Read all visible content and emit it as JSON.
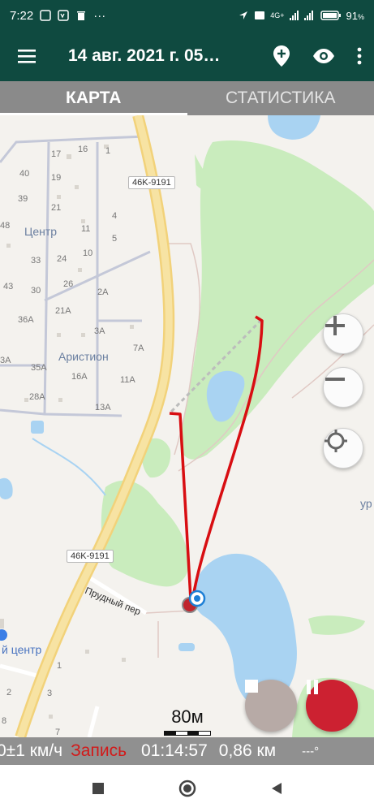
{
  "status_bar": {
    "time": "7:22",
    "more": "···",
    "battery": "91",
    "battery_unit": "%",
    "network": "4G+"
  },
  "app_bar": {
    "title": "14 авг. 2021 г. 05…"
  },
  "tabs": [
    {
      "label": "КАРТА",
      "active": true
    },
    {
      "label": "СТАТИСТИКА",
      "active": false
    }
  ],
  "map": {
    "road_labels": [
      "46K-9191",
      "46K-9191"
    ],
    "area_labels": [
      "Центр",
      "Аристион"
    ],
    "street_label": "Прудный пер",
    "place_labels": [
      "й центр",
      "ур"
    ],
    "house_numbers": [
      "17",
      "16",
      "1",
      "40",
      "19",
      "39",
      "21",
      "48",
      "11",
      "4",
      "5",
      "33",
      "24",
      "10",
      "43",
      "30",
      "26",
      "2A",
      "36A",
      "21A",
      "3A",
      "7A",
      "3A",
      "35A",
      "16A",
      "11A",
      "28A",
      "13A",
      "1",
      "2",
      "3",
      "7",
      "8"
    ]
  },
  "scale": {
    "label": "80м"
  },
  "controls": {
    "zoom_in_icon": "plus-icon",
    "zoom_out_icon": "minus-icon",
    "locate_icon": "crosshair-icon",
    "stop_icon": "stop-icon",
    "pause_icon": "pause-icon",
    "stop_color": "#b7aaa6",
    "pause_color": "#cc2131"
  },
  "info_bar": {
    "speed": "0±1 км/ч",
    "recording": "Запись",
    "duration": "01:14:57",
    "distance": "0,86 км",
    "bearing": "---°"
  },
  "colors": {
    "primary": "#0f4a40",
    "track": "#d80e12",
    "water": "#a9d3f2",
    "park": "#c9ecbd"
  }
}
